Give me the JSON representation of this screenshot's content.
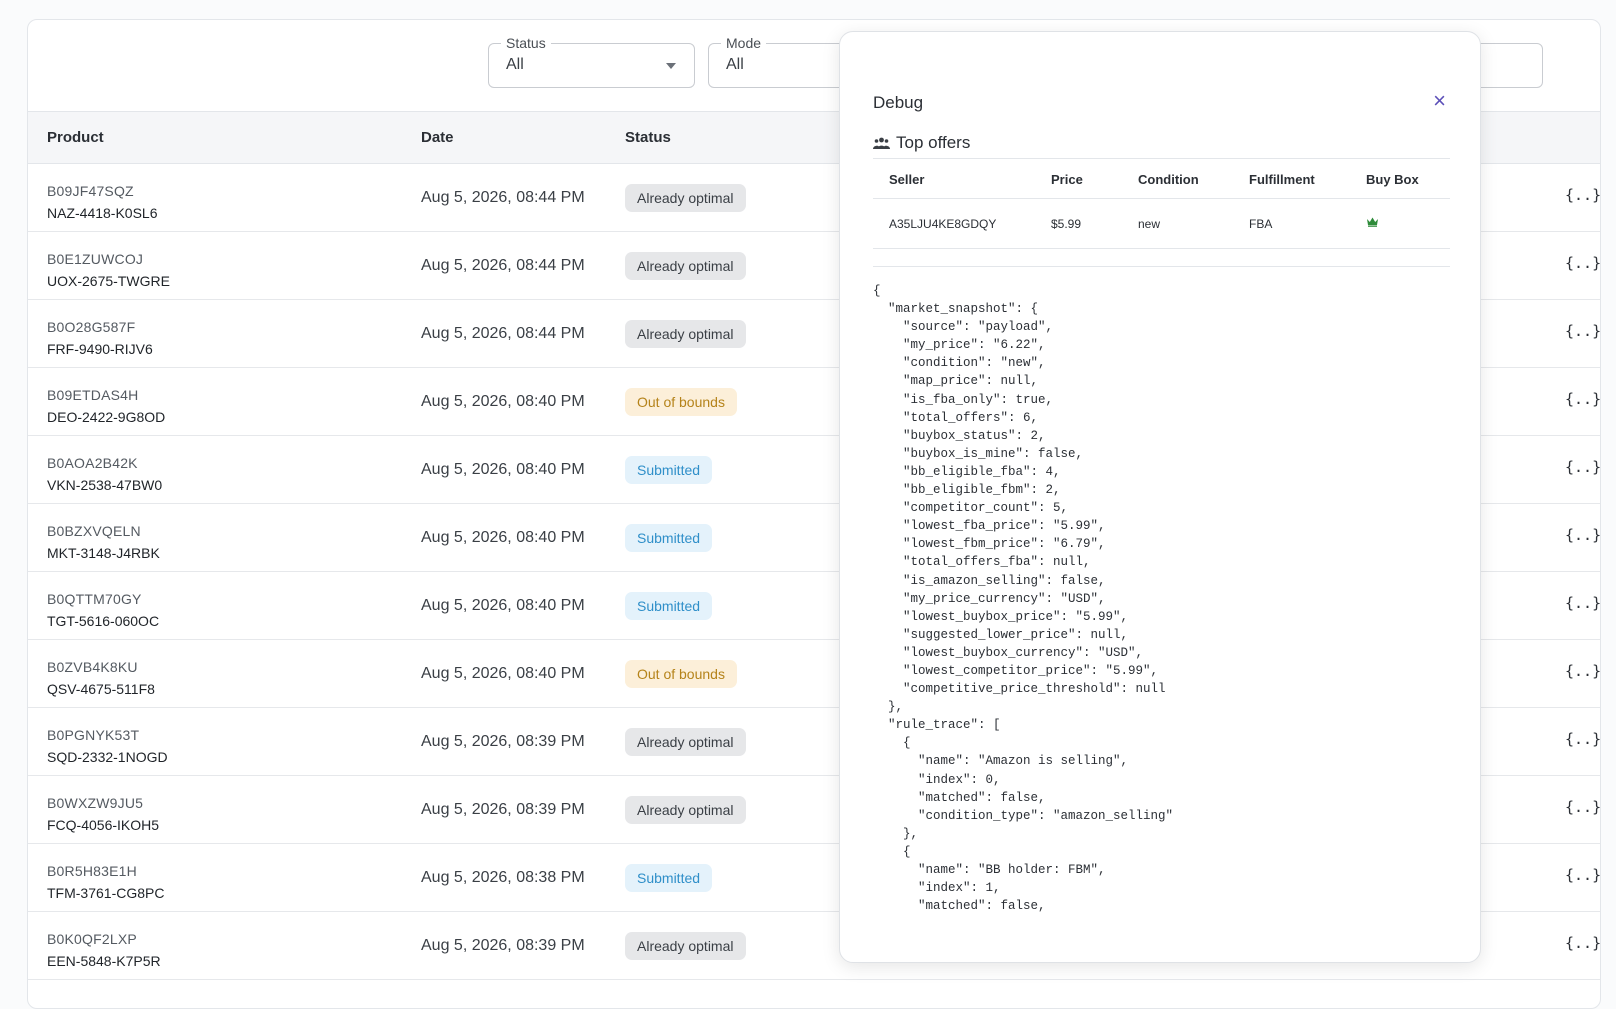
{
  "filters": {
    "status": {
      "label": "Status",
      "value": "All"
    },
    "mode": {
      "label": "Mode",
      "value": "All"
    }
  },
  "table": {
    "headers": {
      "product": "Product",
      "date": "Date",
      "status": "Status"
    },
    "rows": [
      {
        "asin": "B09JF47SQZ",
        "sku": "NAZ-4418-K0SL6",
        "date": "Aug 5, 2026, 08:44 PM",
        "status": "Already optimal",
        "kind": "optimal"
      },
      {
        "asin": "B0E1ZUWCOJ",
        "sku": "UOX-2675-TWGRE",
        "date": "Aug 5, 2026, 08:44 PM",
        "status": "Already optimal",
        "kind": "optimal"
      },
      {
        "asin": "B0O28G587F",
        "sku": "FRF-9490-RIJV6",
        "date": "Aug 5, 2026, 08:44 PM",
        "status": "Already optimal",
        "kind": "optimal"
      },
      {
        "asin": "B09ETDAS4H",
        "sku": "DEO-2422-9G8OD",
        "date": "Aug 5, 2026, 08:40 PM",
        "status": "Out of bounds",
        "kind": "oob"
      },
      {
        "asin": "B0AOA2B42K",
        "sku": "VKN-2538-47BW0",
        "date": "Aug 5, 2026, 08:40 PM",
        "status": "Submitted",
        "kind": "sub"
      },
      {
        "asin": "B0BZXVQELN",
        "sku": "MKT-3148-J4RBK",
        "date": "Aug 5, 2026, 08:40 PM",
        "status": "Submitted",
        "kind": "sub"
      },
      {
        "asin": "B0QTTM70GY",
        "sku": "TGT-5616-060OC",
        "date": "Aug 5, 2026, 08:40 PM",
        "status": "Submitted",
        "kind": "sub"
      },
      {
        "asin": "B0ZVB4K8KU",
        "sku": "QSV-4675-511F8",
        "date": "Aug 5, 2026, 08:40 PM",
        "status": "Out of bounds",
        "kind": "oob"
      },
      {
        "asin": "B0PGNYK53T",
        "sku": "SQD-2332-1NOGD",
        "date": "Aug 5, 2026, 08:39 PM",
        "status": "Already optimal",
        "kind": "optimal"
      },
      {
        "asin": "B0WXZW9JU5",
        "sku": "FCQ-4056-IKOH5",
        "date": "Aug 5, 2026, 08:39 PM",
        "status": "Already optimal",
        "kind": "optimal"
      },
      {
        "asin": "B0R5H83E1H",
        "sku": "TFM-3761-CG8PC",
        "date": "Aug 5, 2026, 08:38 PM",
        "status": "Submitted",
        "kind": "sub"
      },
      {
        "asin": "B0K0QF2LXP",
        "sku": "EEN-5848-K7P5R",
        "date": "Aug 5, 2026, 08:39 PM",
        "status": "Already optimal",
        "kind": "optimal"
      }
    ],
    "json_icon_label": "{..}"
  },
  "modal": {
    "title": "Debug",
    "close_label": "×",
    "subtitle": "Top offers",
    "offers_headers": {
      "seller": "Seller",
      "price": "Price",
      "condition": "Condition",
      "fulfillment": "Fulfillment",
      "buybox": "Buy Box"
    },
    "offers": [
      {
        "seller": "A35LJU4KE8GDQY",
        "price": "$5.99",
        "condition": "new",
        "fulfillment": "FBA",
        "buybox_icon": "crown-icon"
      }
    ],
    "json_text": "{\n  \"market_snapshot\": {\n    \"source\": \"payload\",\n    \"my_price\": \"6.22\",\n    \"condition\": \"new\",\n    \"map_price\": null,\n    \"is_fba_only\": true,\n    \"total_offers\": 6,\n    \"buybox_status\": 2,\n    \"buybox_is_mine\": false,\n    \"bb_eligible_fba\": 4,\n    \"bb_eligible_fbm\": 2,\n    \"competitor_count\": 5,\n    \"lowest_fba_price\": \"5.99\",\n    \"lowest_fbm_price\": \"6.79\",\n    \"total_offers_fba\": null,\n    \"is_amazon_selling\": false,\n    \"my_price_currency\": \"USD\",\n    \"lowest_buybox_price\": \"5.99\",\n    \"suggested_lower_price\": null,\n    \"lowest_buybox_currency\": \"USD\",\n    \"lowest_competitor_price\": \"5.99\",\n    \"competitive_price_threshold\": null\n  },\n  \"rule_trace\": [\n    {\n      \"name\": \"Amazon is selling\",\n      \"index\": 0,\n      \"matched\": false,\n      \"condition_type\": \"amazon_selling\"\n    },\n    {\n      \"name\": \"BB holder: FBM\",\n      \"index\": 1,\n      \"matched\": false,"
  },
  "colors": {
    "accent": "#5b4fb8",
    "crown": "#2e8b3a"
  }
}
